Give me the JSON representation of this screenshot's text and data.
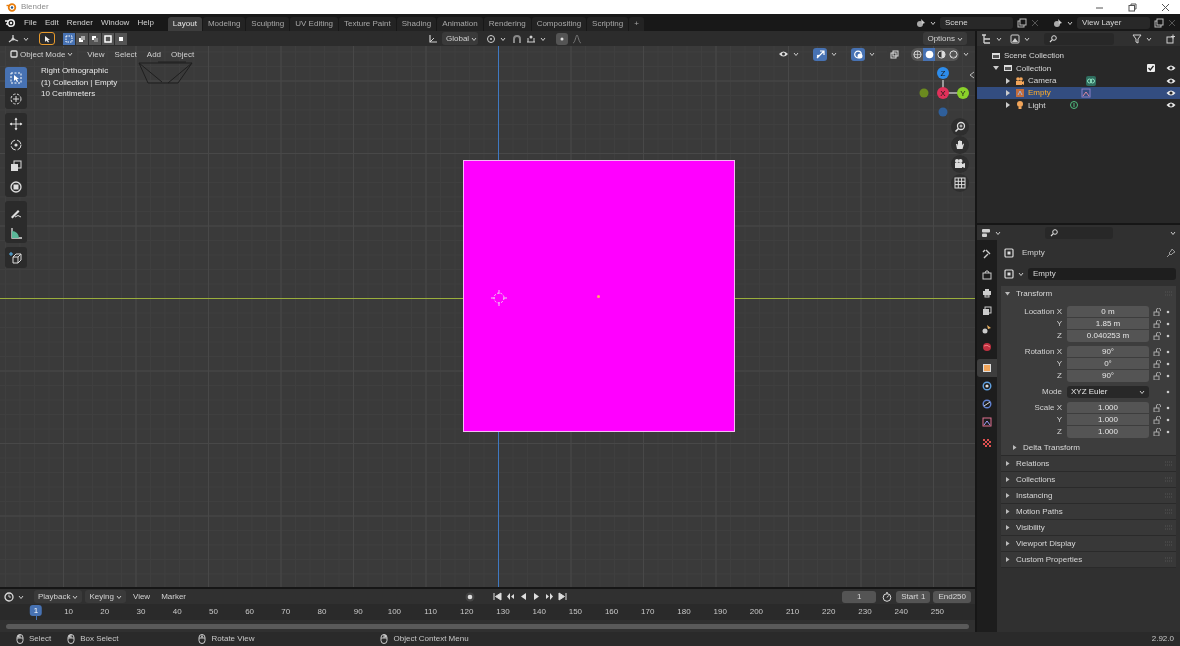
{
  "window": {
    "title": "Blender"
  },
  "menu": [
    "File",
    "Edit",
    "Render",
    "Window",
    "Help"
  ],
  "workspaces": [
    {
      "label": "Layout",
      "selected": true
    },
    {
      "label": "Modeling",
      "selected": false
    },
    {
      "label": "Sculpting",
      "selected": false
    },
    {
      "label": "UV Editing",
      "selected": false
    },
    {
      "label": "Texture Paint",
      "selected": false
    },
    {
      "label": "Shading",
      "selected": false
    },
    {
      "label": "Animation",
      "selected": false
    },
    {
      "label": "Rendering",
      "selected": false
    },
    {
      "label": "Compositing",
      "selected": false
    },
    {
      "label": "Scripting",
      "selected": false
    }
  ],
  "add_workspace": "+",
  "scene": "Scene",
  "view_layer": "View Layer",
  "tool_header": {
    "select_modes": [
      {
        "selected": true
      },
      {
        "selected": false
      },
      {
        "selected": false
      },
      {
        "selected": false
      },
      {
        "selected": false
      }
    ],
    "orientation": "Global",
    "options": "Options"
  },
  "viewport_header": {
    "mode": "Object Mode",
    "menus": [
      "View",
      "Select",
      "Add",
      "Object"
    ],
    "gizmos_on": true,
    "overlays_on": true,
    "xray_on": false,
    "shading": [
      {
        "selected": false
      },
      {
        "selected": true
      },
      {
        "selected": false
      },
      {
        "selected": false
      }
    ]
  },
  "viewport": {
    "info": [
      "Right Orthographic",
      "(1) Collection | Empty",
      "10 Centimeters"
    ],
    "tools": [
      {
        "selected": true
      },
      {
        "selected": false
      },
      {
        "selected": false
      },
      {
        "selected": false
      },
      {
        "selected": false
      },
      {
        "selected": false
      },
      {
        "selected": false
      },
      {
        "selected": false
      },
      {
        "selected": false
      }
    ],
    "gizmo_axes": [
      "X",
      "Y",
      "Z"
    ]
  },
  "outliner": {
    "tree": [
      {
        "label": "Scene Collection",
        "kind": "scene_collection",
        "selected": false,
        "children": [
          {
            "label": "Collection",
            "kind": "collection",
            "selected": false,
            "expanded": true,
            "checked": true,
            "visible": true,
            "children": [
              {
                "label": "Camera",
                "kind": "camera",
                "selected": false,
                "expanded": false,
                "visible": true
              },
              {
                "label": "Empty",
                "kind": "empty",
                "selected": true,
                "expanded": false,
                "visible": true
              },
              {
                "label": "Light",
                "kind": "light",
                "selected": false,
                "expanded": false,
                "visible": true
              }
            ]
          }
        ]
      }
    ]
  },
  "properties": {
    "tabs": [
      {
        "selected": false
      },
      {
        "selected": false
      },
      {
        "selected": false
      },
      {
        "selected": false
      },
      {
        "selected": false
      },
      {
        "selected": false
      },
      {
        "selected": true
      },
      {
        "selected": false
      },
      {
        "selected": false
      },
      {
        "selected": false
      },
      {
        "selected": false
      }
    ],
    "object": "Empty",
    "name": "Empty",
    "panels": [
      {
        "label": "Transform",
        "expanded": true,
        "groups": [
          [
            {
              "kind": "number",
              "label": "Location X",
              "value": "0 m"
            },
            {
              "kind": "number",
              "label": "Y",
              "value": "1.85 m"
            },
            {
              "kind": "number",
              "label": "Z",
              "value": "0.040253 m"
            }
          ],
          [
            {
              "kind": "number",
              "label": "Rotation X",
              "value": "90°"
            },
            {
              "kind": "number",
              "label": "Y",
              "value": "0°"
            },
            {
              "kind": "number",
              "label": "Z",
              "value": "90°"
            }
          ],
          [
            {
              "kind": "dropdown",
              "label": "Mode",
              "value": "XYZ Euler"
            }
          ],
          [
            {
              "kind": "number",
              "label": "Scale X",
              "value": "1.000"
            },
            {
              "kind": "number",
              "label": "Y",
              "value": "1.000"
            },
            {
              "kind": "number",
              "label": "Z",
              "value": "1.000"
            }
          ]
        ],
        "subpanels": [
          {
            "label": "Delta Transform",
            "expanded": false
          }
        ]
      },
      {
        "label": "Relations",
        "expanded": false
      },
      {
        "label": "Collections",
        "expanded": false
      },
      {
        "label": "Instancing",
        "expanded": false
      },
      {
        "label": "Motion Paths",
        "expanded": false
      },
      {
        "label": "Visibility",
        "expanded": false
      },
      {
        "label": "Viewport Display",
        "expanded": false
      },
      {
        "label": "Custom Properties",
        "expanded": false
      }
    ]
  },
  "timeline": {
    "menus": [
      {
        "label": "Playback",
        "kind": "dropdown"
      },
      {
        "label": "Keying",
        "kind": "dropdown"
      },
      {
        "label": "View",
        "kind": "menu"
      },
      {
        "label": "Marker",
        "kind": "menu"
      }
    ],
    "current_frame": "1",
    "start": {
      "label": "Start",
      "value": "1"
    },
    "end": {
      "label": "End",
      "value": "250"
    },
    "ruler": [
      {
        "label": "1",
        "selected": true
      },
      {
        "label": "10",
        "selected": false
      },
      {
        "label": "20",
        "selected": false
      },
      {
        "label": "30",
        "selected": false
      },
      {
        "label": "40",
        "selected": false
      },
      {
        "label": "50",
        "selected": false
      },
      {
        "label": "60",
        "selected": false
      },
      {
        "label": "70",
        "selected": false
      },
      {
        "label": "80",
        "selected": false
      },
      {
        "label": "90",
        "selected": false
      },
      {
        "label": "100",
        "selected": false
      },
      {
        "label": "110",
        "selected": false
      },
      {
        "label": "120",
        "selected": false
      },
      {
        "label": "130",
        "selected": false
      },
      {
        "label": "140",
        "selected": false
      },
      {
        "label": "150",
        "selected": false
      },
      {
        "label": "160",
        "selected": false
      },
      {
        "label": "170",
        "selected": false
      },
      {
        "label": "180",
        "selected": false
      },
      {
        "label": "190",
        "selected": false
      },
      {
        "label": "200",
        "selected": false
      },
      {
        "label": "210",
        "selected": false
      },
      {
        "label": "220",
        "selected": false
      },
      {
        "label": "230",
        "selected": false
      },
      {
        "label": "240",
        "selected": false
      },
      {
        "label": "250",
        "selected": false
      }
    ]
  },
  "status": {
    "hints": [
      "Select",
      "Box Select",
      "Rotate View",
      "Object Context Menu"
    ],
    "version": "2.92.0"
  }
}
